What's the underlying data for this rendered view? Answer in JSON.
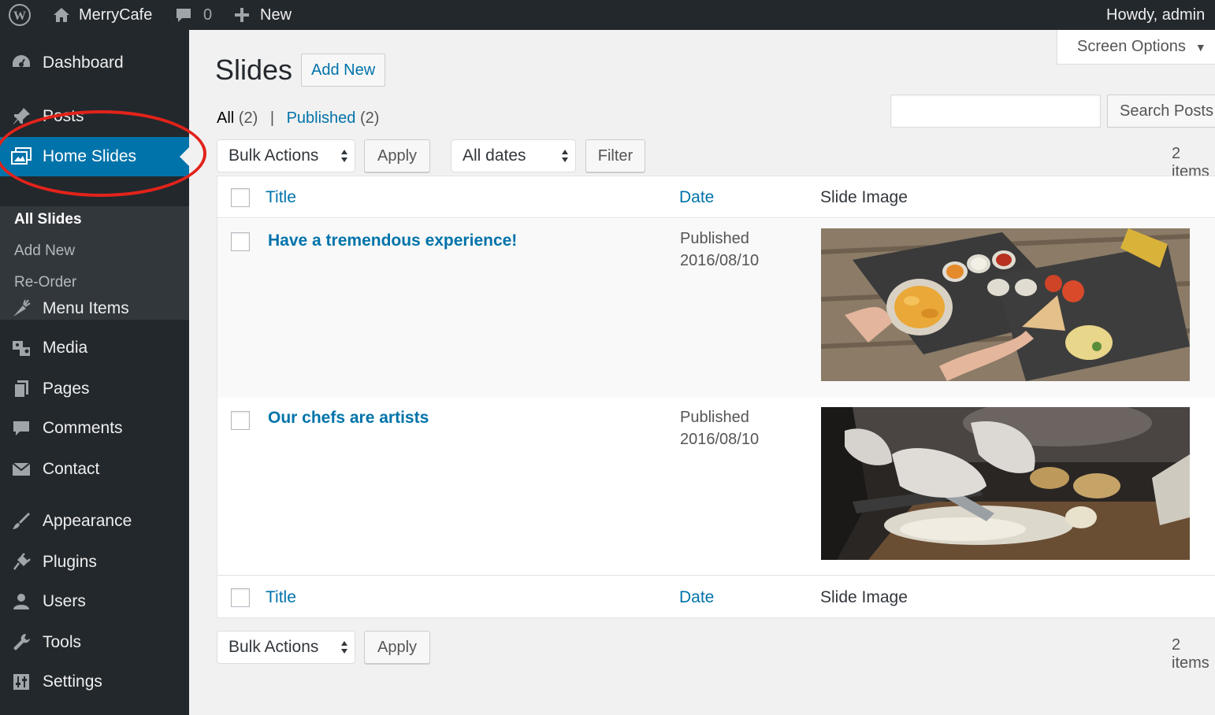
{
  "adminbar": {
    "site_name": "MerryCafe",
    "comments_count": "0",
    "new_label": "New",
    "greeting": "Howdy, admin"
  },
  "sidebar": {
    "items": [
      {
        "label": "Dashboard",
        "icon": "dashboard-icon"
      },
      {
        "label": "Posts",
        "icon": "pin-icon"
      },
      {
        "label": "Home Slides",
        "icon": "slides-icon",
        "current": true
      },
      {
        "label": "Menu Items",
        "icon": "carrot-icon"
      },
      {
        "label": "Media",
        "icon": "media-icon"
      },
      {
        "label": "Pages",
        "icon": "pages-icon"
      },
      {
        "label": "Comments",
        "icon": "comment-icon"
      },
      {
        "label": "Contact",
        "icon": "mail-icon"
      },
      {
        "label": "Appearance",
        "icon": "brush-icon"
      },
      {
        "label": "Plugins",
        "icon": "plugin-icon"
      },
      {
        "label": "Users",
        "icon": "user-icon"
      },
      {
        "label": "Tools",
        "icon": "wrench-icon"
      },
      {
        "label": "Settings",
        "icon": "settings-icon"
      }
    ],
    "submenu": [
      "All Slides",
      "Add New",
      "Re-Order"
    ]
  },
  "header": {
    "screen_options": "Screen Options",
    "title": "Slides",
    "add_new": "Add New"
  },
  "filters": {
    "all_label": "All",
    "all_count": "(2)",
    "separator": "|",
    "published_label": "Published",
    "published_count": "(2)",
    "search_button": "Search Posts",
    "search_value": "",
    "bulk_actions": "Bulk Actions",
    "apply": "Apply",
    "all_dates": "All dates",
    "filter": "Filter",
    "items_count": "2 items"
  },
  "table": {
    "columns": [
      "Title",
      "Date",
      "Slide Image"
    ],
    "rows": [
      {
        "title": "Have a tremendous experience!",
        "status": "Published",
        "date": "2016/08/10",
        "image": "food-platter-photo"
      },
      {
        "title": "Our chefs are artists",
        "status": "Published",
        "date": "2016/08/10",
        "image": "chef-chopping-photo"
      }
    ]
  },
  "colors": {
    "accent": "#0073aa",
    "admin_dark": "#23282d",
    "highlight_circle": "#e2231a"
  }
}
